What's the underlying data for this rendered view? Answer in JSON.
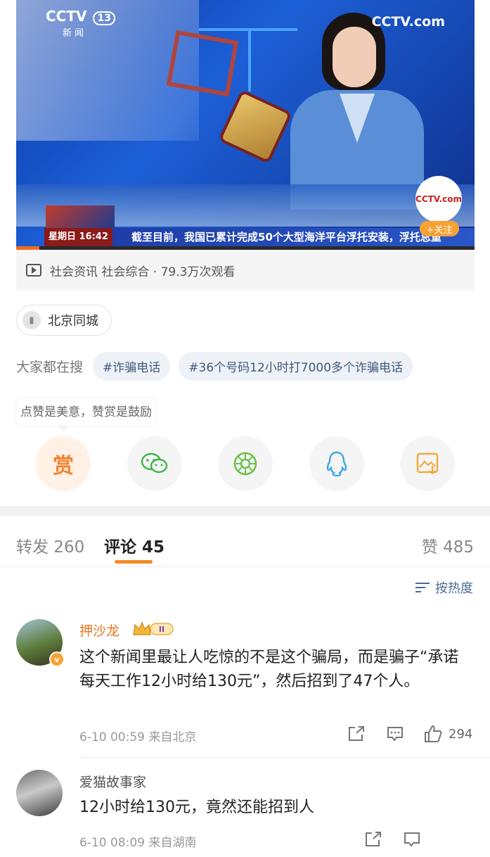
{
  "video": {
    "channel_logo": "CCTV",
    "channel_number": "13",
    "channel_sub": "新闻",
    "brand_logo": "CCTV.com",
    "brand_badge": "CCTV.com",
    "follow_label": "+关注",
    "ticker_day": "星期日  16:42",
    "ticker_text": "截至目前，我国已累计完成50个大型海洋平台浮托安装，浮托总重",
    "progress_fraction": 0.05
  },
  "meta": {
    "text": "社会资讯 社会综合 · 79.3万次观看"
  },
  "location": {
    "label": "北京同城"
  },
  "search": {
    "label": "大家都在搜",
    "tags": [
      "#诈骗电话",
      "#36个号码12小时打7000多个诈骗电话"
    ]
  },
  "reward_tip": "点赞是美意，赞赏是鼓励",
  "share": {
    "reward_label": "赏"
  },
  "tabs": {
    "forward": "转发 260",
    "comments": "评论 45",
    "likes": "赞 485"
  },
  "sort": {
    "label": "按热度"
  },
  "comments": [
    {
      "user": "押沙龙",
      "level": "II",
      "text": "这个新闻里最让人吃惊的不是这个骗局，而是骗子“承诺每天工作12小时给130元”，然后招到了47个人。",
      "time": "6-10 00:59 来自北京",
      "likes": "294"
    },
    {
      "user": "爱猫故事家",
      "text": "12小时给130元，竟然还能招到人",
      "time": "6-10 08:09 来自湖南"
    }
  ],
  "colors": {
    "accent": "#f28c28",
    "link": "#4a6b96",
    "username_vip": "#e9771f"
  }
}
